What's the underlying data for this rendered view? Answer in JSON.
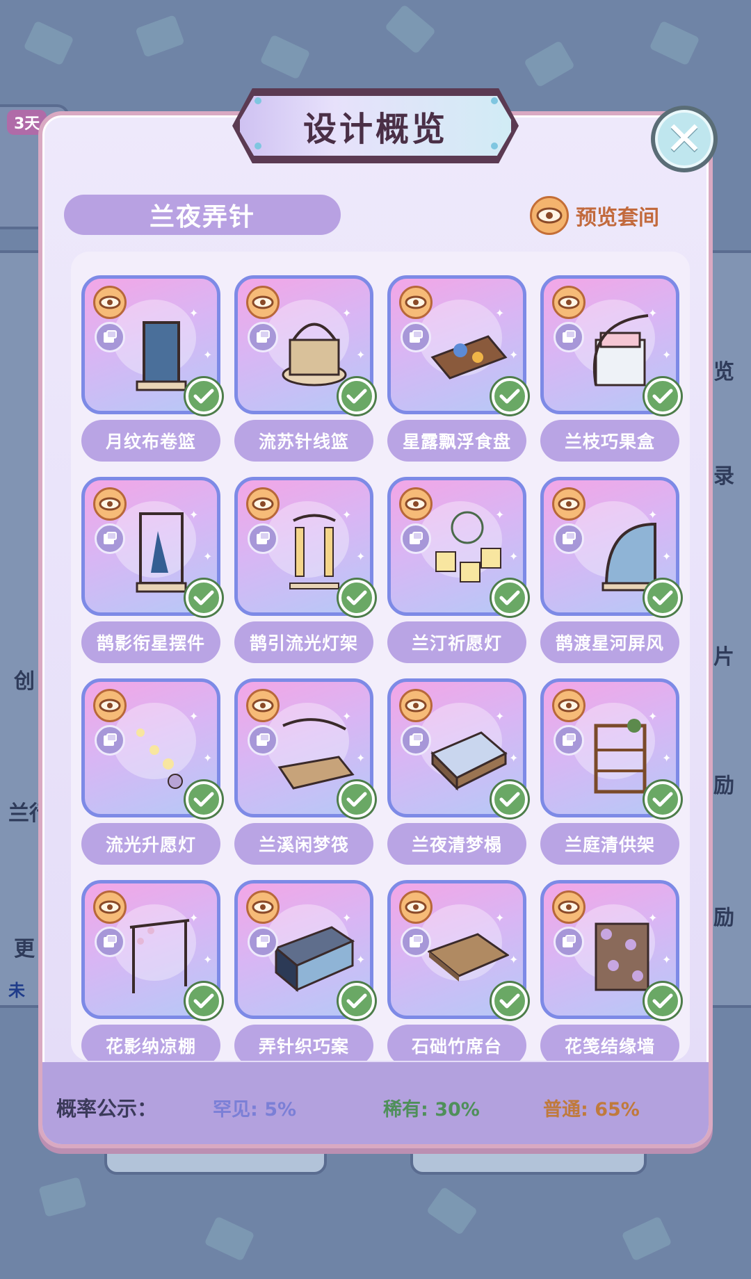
{
  "background": {
    "left_badge": "3天",
    "right_labels": [
      "览",
      "录",
      "片",
      "励",
      "励"
    ],
    "left_labels": [
      "创",
      "兰行",
      "更",
      "未"
    ]
  },
  "modal": {
    "title": "设计概览",
    "set_name": "兰夜弄针",
    "preview_suite_label": "预览套间"
  },
  "items": [
    {
      "name": "月纹布卷篮",
      "icon": "cabinet-icon",
      "owned": true
    },
    {
      "name": "流苏针线篮",
      "icon": "basket-icon",
      "owned": true
    },
    {
      "name": "星露飘浮食盘",
      "icon": "tray-icon",
      "owned": true
    },
    {
      "name": "兰枝巧果盒",
      "icon": "box-icon",
      "owned": true
    },
    {
      "name": "鹊影衔星摆件",
      "icon": "ornament-icon",
      "owned": true
    },
    {
      "name": "鹊引流光灯架",
      "icon": "lamp-stand-icon",
      "owned": true
    },
    {
      "name": "兰汀祈愿灯",
      "icon": "lantern-icon",
      "owned": true
    },
    {
      "name": "鹊渡星河屏风",
      "icon": "screen-icon",
      "owned": true
    },
    {
      "name": "流光升愿灯",
      "icon": "floating-lantern-icon",
      "owned": true
    },
    {
      "name": "兰溪闲梦筏",
      "icon": "raft-icon",
      "owned": true
    },
    {
      "name": "兰夜清梦榻",
      "icon": "daybed-icon",
      "owned": true
    },
    {
      "name": "兰庭清供架",
      "icon": "shelf-icon",
      "owned": true
    },
    {
      "name": "花影纳凉棚",
      "icon": "arbor-icon",
      "owned": true
    },
    {
      "name": "弄针织巧案",
      "icon": "desk-icon",
      "owned": true
    },
    {
      "name": "石础竹席台",
      "icon": "platform-icon",
      "owned": true
    },
    {
      "name": "花笺结缘墙",
      "icon": "flower-wall-icon",
      "owned": true
    }
  ],
  "probability": {
    "title": "概率公示：",
    "rare": "罕见: 5%",
    "uncommon": "稀有: 30%",
    "common": "普通: 65%"
  },
  "colors": {
    "rare": "#7b7fd6",
    "uncommon": "#4f8f5a",
    "common": "#c07a3c",
    "accent_purple": "#b9a4e4",
    "check_green": "#6aa865"
  }
}
